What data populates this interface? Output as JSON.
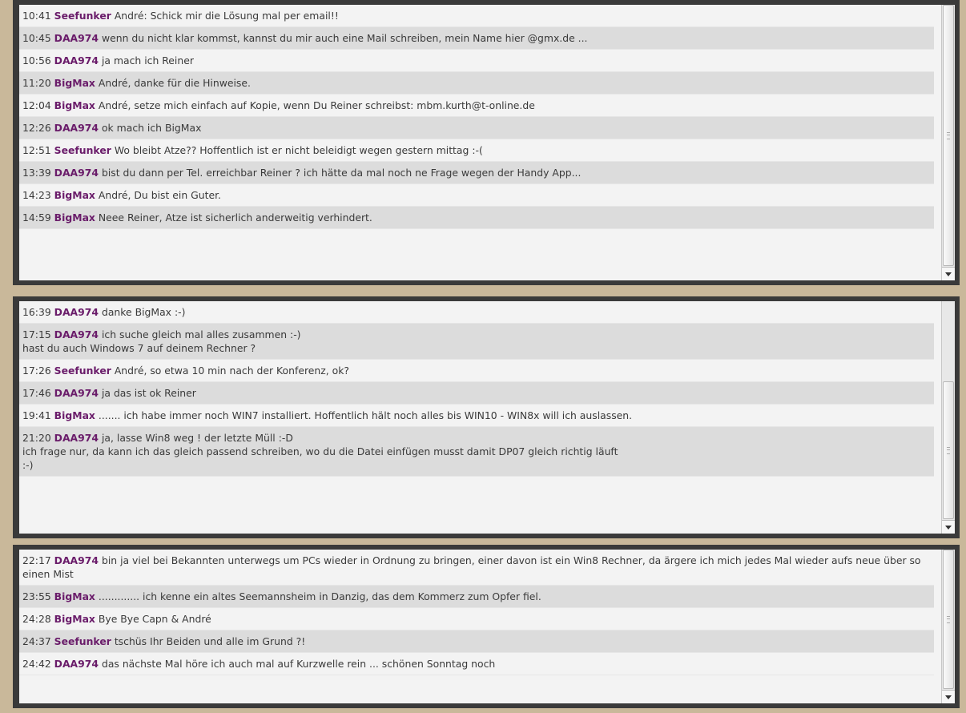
{
  "chat_panels": [
    {
      "messages": [
        {
          "time": "10:41",
          "user": "Seefunker",
          "text": "André: Schick mir die Lösung mal per email!!"
        },
        {
          "time": "10:45",
          "user": "DAA974",
          "text": "wenn du nicht klar kommst, kannst du mir auch eine Mail schreiben, mein Name hier @gmx.de ..."
        },
        {
          "time": "10:56",
          "user": "DAA974",
          "text": "ja mach ich Reiner"
        },
        {
          "time": "11:20",
          "user": "BigMax",
          "text": "André, danke für die Hinweise."
        },
        {
          "time": "12:04",
          "user": "BigMax",
          "text": "André, setze mich einfach auf Kopie, wenn Du Reiner schreibst: mbm.kurth@t-online.de"
        },
        {
          "time": "12:26",
          "user": "DAA974",
          "text": "ok mach ich BigMax"
        },
        {
          "time": "12:51",
          "user": "Seefunker",
          "text": "Wo bleibt Atze?? Hoffentlich ist er nicht beleidigt wegen gestern mittag :-("
        },
        {
          "time": "13:39",
          "user": "DAA974",
          "text": "bist du dann per Tel. erreichbar Reiner ? ich hätte da mal noch ne Frage wegen der Handy App..."
        },
        {
          "time": "14:23",
          "user": "BigMax",
          "text": "André, Du bist ein Guter."
        },
        {
          "time": "14:59",
          "user": "BigMax",
          "text": "Neee Reiner, Atze ist sicherlich anderweitig verhindert."
        }
      ]
    },
    {
      "messages": [
        {
          "time": "16:39",
          "user": "DAA974",
          "text": "danke BigMax :-)"
        },
        {
          "time": "17:15",
          "user": "DAA974",
          "text": "ich suche gleich mal alles zusammen :-)\nhast du auch Windows 7 auf deinem Rechner ?"
        },
        {
          "time": "17:26",
          "user": "Seefunker",
          "text": "André, so etwa 10 min nach der Konferenz, ok?"
        },
        {
          "time": "17:46",
          "user": "DAA974",
          "text": "ja das ist ok Reiner"
        },
        {
          "time": "19:41",
          "user": "BigMax",
          "text": "....... ich habe immer noch WIN7 installiert. Hoffentlich hält noch alles bis WIN10 - WIN8x will ich auslassen."
        },
        {
          "time": "21:20",
          "user": "DAA974",
          "text": "ja, lasse Win8 weg ! der letzte Müll :-D\nich frage nur, da kann ich das gleich passend schreiben, wo du die Datei einfügen musst damit DP07 gleich richtig läuft\n:-)"
        }
      ]
    },
    {
      "messages": [
        {
          "time": "22:17",
          "user": "DAA974",
          "text": "bin ja viel bei Bekannten unterwegs um PCs wieder in Ordnung zu bringen, einer davon ist ein Win8 Rechner, da ärgere ich mich jedes Mal wieder aufs neue über so einen Mist"
        },
        {
          "time": "23:55",
          "user": "BigMax",
          "text": "............. ich kenne ein altes Seemannsheim in Danzig, das dem Kommerz zum Opfer fiel."
        },
        {
          "time": "24:28",
          "user": "BigMax",
          "text": "Bye Bye Capn & André"
        },
        {
          "time": "24:37",
          "user": "Seefunker",
          "text": "tschüs Ihr Beiden und alle im Grund ?!"
        },
        {
          "time": "24:42",
          "user": "DAA974",
          "text": "das nächste Mal höre ich auch mal auf Kurzwelle rein ... schönen Sonntag noch"
        }
      ]
    }
  ]
}
